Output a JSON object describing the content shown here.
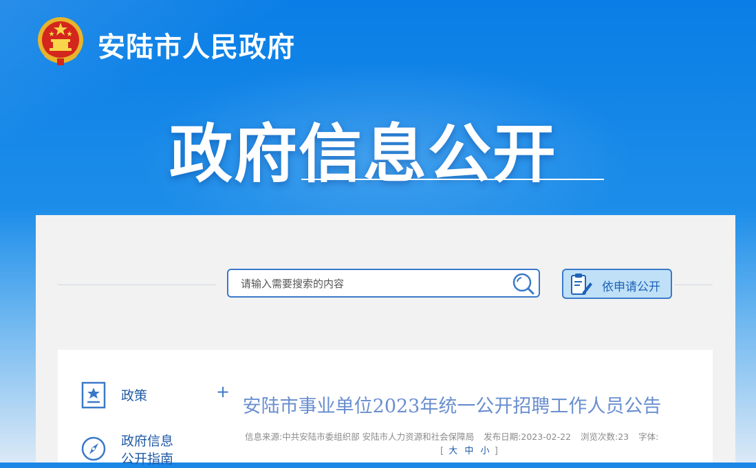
{
  "site": {
    "name": "安陆市人民政府"
  },
  "banner": {
    "title": "政府信息公开"
  },
  "search": {
    "placeholder": "请输入需要搜索的内容"
  },
  "apply_button": {
    "label": "依申请公开"
  },
  "sidebar": {
    "items": [
      {
        "label": "政策",
        "icon": "star-document-icon"
      },
      {
        "label_line1": "政府信息",
        "label_line2": "公开指南",
        "icon": "compass-icon"
      }
    ]
  },
  "article": {
    "title": "安陆市事业单位2023年统一公开招聘工作人员公告",
    "source": "信息来源:中共安陆市委组织部 安陆市人力资源和社会保障局",
    "publish_date": "发布日期:2023-02-22",
    "views": "浏览次数:23",
    "font_label": "字体:",
    "font_open": "[",
    "font_large": "大",
    "font_medium": "中",
    "font_small": "小",
    "font_close": "]"
  },
  "colors": {
    "brand_blue": "#0a7ee6",
    "accent": "#3a79c9",
    "title": "#6a8fcf"
  }
}
